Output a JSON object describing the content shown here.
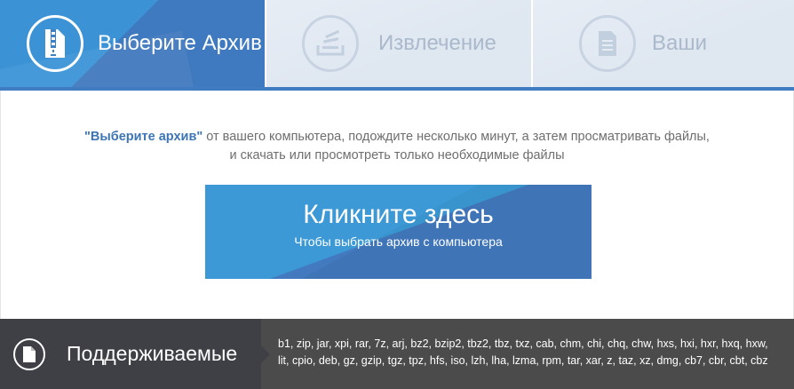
{
  "steps": [
    {
      "label": "Выберите Архив",
      "icon": "archive-file-icon",
      "active": true
    },
    {
      "label": "Извлечение",
      "icon": "extract-tray-icon",
      "active": false
    },
    {
      "label": "Ваши",
      "icon": "document-icon",
      "active": false
    }
  ],
  "intro": {
    "emphasis": "\"Выберите архив\"",
    "line1_rest": " от вашего компьютера, подождите несколько минут, а затем просматривать файлы,",
    "line2": "и скачать или просмотреть только необходимые файлы"
  },
  "click_button": {
    "title": "Кликните здесь",
    "subtitle": "Чтобы выбрать архив с компьютера"
  },
  "supported": {
    "label": "Поддерживаемые",
    "icon": "file-icon",
    "formats": "b1, zip, jar, xpi, rar, 7z, arj, bz2, bzip2, tbz2, tbz, txz, cab, chm, chi, chq, chw, hxs, hxi, hxr, hxq, hxw, lit, cpio, deb, gz, gzip, tgz, tpz, hfs, iso, lzh, lha, lzma, rpm, tar, xar, z, taz, xz, dmg, cb7, cbr, cbt, cbz"
  },
  "colors": {
    "accent_blue": "#3f7cc2",
    "light_blue": "#3c99d6",
    "inactive_tab": "#dfe7f1",
    "dark_bar": "#4b4b4b"
  }
}
